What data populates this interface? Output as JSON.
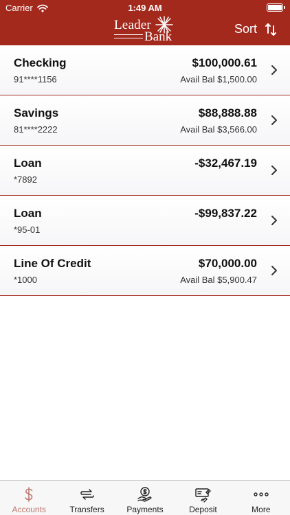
{
  "status": {
    "carrier": "Carrier",
    "time": "1:49 AM"
  },
  "header": {
    "logo_top": "Leader",
    "logo_bottom": "Bank",
    "sort_label": "Sort",
    "brand_color": "#a3291d"
  },
  "accounts": [
    {
      "name": "Checking",
      "number": "91****1156",
      "balance": "$100,000.61",
      "avail": "Avail Bal $1,500.00"
    },
    {
      "name": "Savings",
      "number": "81****2222",
      "balance": "$88,888.88",
      "avail": "Avail Bal $3,566.00"
    },
    {
      "name": "Loan",
      "number": "*7892",
      "balance": "-$32,467.19",
      "avail": ""
    },
    {
      "name": "Loan",
      "number": "*95-01",
      "balance": "-$99,837.22",
      "avail": ""
    },
    {
      "name": "Line Of Credit",
      "number": "*1000",
      "balance": "$70,000.00",
      "avail": "Avail Bal $5,900.47"
    }
  ],
  "tabs": [
    {
      "label": "Accounts",
      "icon": "dollar-icon",
      "active": true
    },
    {
      "label": "Transfers",
      "icon": "transfer-arrows-icon",
      "active": false
    },
    {
      "label": "Payments",
      "icon": "hand-coin-icon",
      "active": false
    },
    {
      "label": "Deposit",
      "icon": "check-deposit-icon",
      "active": false
    },
    {
      "label": "More",
      "icon": "more-dots-icon",
      "active": false
    }
  ]
}
